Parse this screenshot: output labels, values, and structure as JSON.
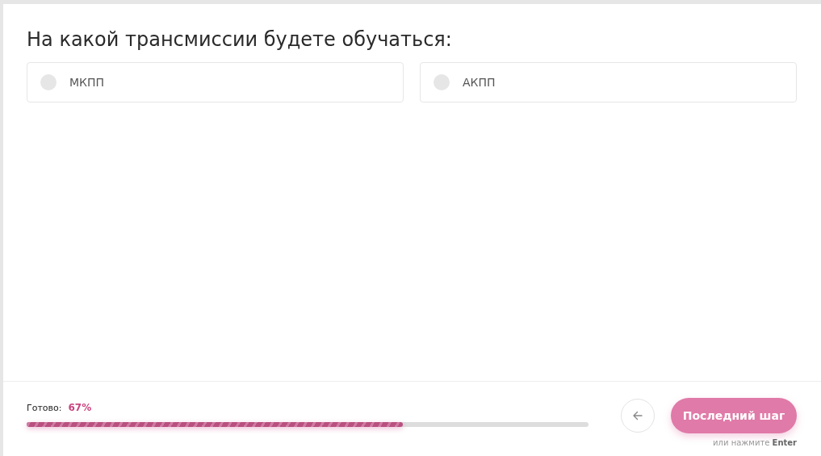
{
  "question": {
    "title": "На какой трансмиссии будете обучаться:"
  },
  "options": [
    {
      "label": "МКПП",
      "selected": false
    },
    {
      "label": "АКПП",
      "selected": false
    }
  ],
  "progress": {
    "label": "Готово:",
    "reading": "67%",
    "level": 0.67
  },
  "next_button": {
    "label": "Последний шаг"
  },
  "hint": "или нажмите **Enter**"
}
